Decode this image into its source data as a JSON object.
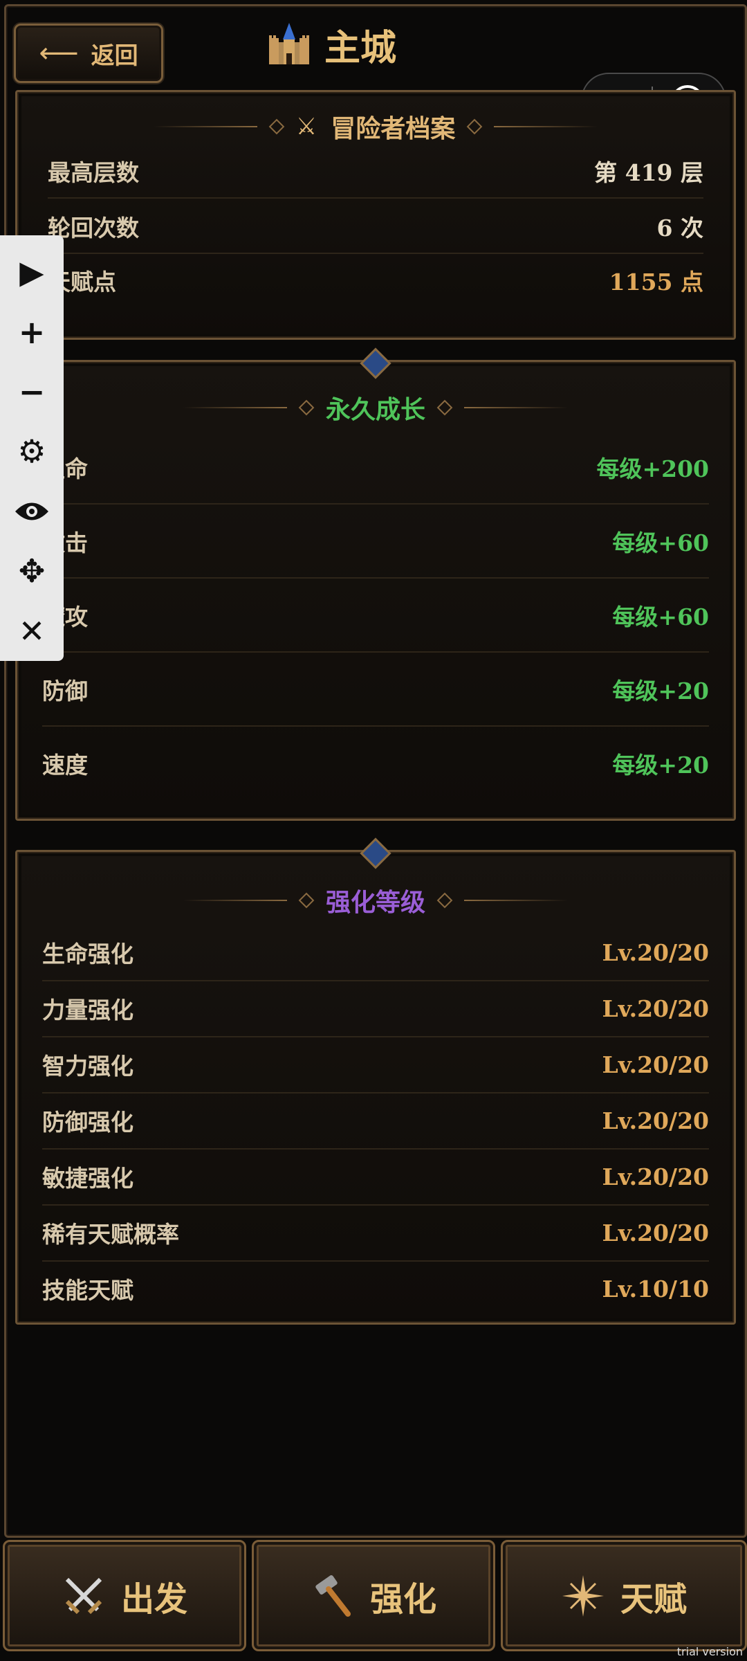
{
  "header": {
    "back_label": "返回",
    "title": "主城"
  },
  "capsule": {
    "more": "•••"
  },
  "profile": {
    "title": "冒险者档案",
    "rows": [
      {
        "label": "最高层数",
        "value": "第 419 层"
      },
      {
        "label": "轮回次数",
        "value": "6 次"
      },
      {
        "label": "天赋点",
        "value": "1155 点"
      }
    ]
  },
  "growth": {
    "title": "永久成长",
    "rows": [
      {
        "label": "生命",
        "value": "每级+200"
      },
      {
        "label": "攻击",
        "value": "每级+60"
      },
      {
        "label": "魔攻",
        "value": "每级+60"
      },
      {
        "label": "防御",
        "value": "每级+20"
      },
      {
        "label": "速度",
        "value": "每级+20"
      }
    ]
  },
  "enhance": {
    "title": "强化等级",
    "rows": [
      {
        "label": "生命强化",
        "value": "Lv.20/20"
      },
      {
        "label": "力量强化",
        "value": "Lv.20/20"
      },
      {
        "label": "智力强化",
        "value": "Lv.20/20"
      },
      {
        "label": "防御强化",
        "value": "Lv.20/20"
      },
      {
        "label": "敏捷强化",
        "value": "Lv.20/20"
      },
      {
        "label": "稀有天赋概率",
        "value": "Lv.20/20"
      },
      {
        "label": "技能天赋",
        "value": "Lv.10/10"
      }
    ]
  },
  "nav": [
    {
      "label": "出发",
      "icon": "crossed-swords-icon"
    },
    {
      "label": "强化",
      "icon": "hammer-icon"
    },
    {
      "label": "天赋",
      "icon": "sparkle-icon"
    }
  ],
  "watermark": "trial version",
  "colors": {
    "gold": "#e2b877",
    "green": "#4fc45a",
    "purple": "#9a5ed6",
    "orange": "#e0a85a"
  }
}
